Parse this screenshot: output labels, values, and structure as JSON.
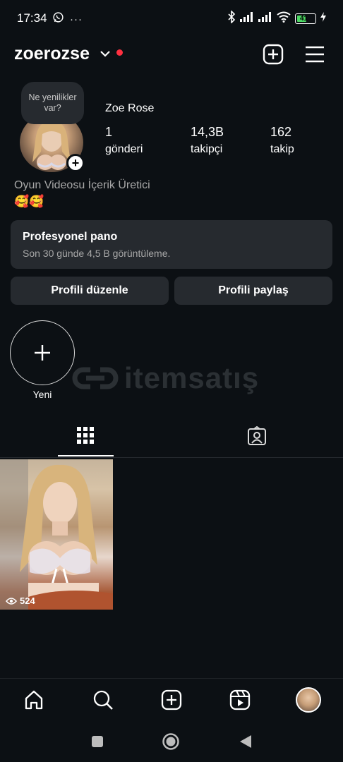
{
  "status_bar": {
    "time": "17:34",
    "more": "···",
    "battery": "41"
  },
  "header": {
    "username": "zoerozse"
  },
  "profile": {
    "note_bubble": "Ne yenilikler var?",
    "display_name": "Zoe Rose",
    "stats": [
      {
        "value": "1",
        "label": "gönderi"
      },
      {
        "value": "14,3B",
        "label": "takipçi"
      },
      {
        "value": "162",
        "label": "takip"
      }
    ],
    "bio": "Oyun Videosu İçerik Üretici",
    "bio_emoji": "🥰🥰"
  },
  "dashboard": {
    "title": "Profesyonel pano",
    "subtitle": "Son 30 günde 4,5 B görüntüleme."
  },
  "buttons": {
    "edit": "Profili düzenle",
    "share": "Profili paylaş"
  },
  "highlights": {
    "new_label": "Yeni"
  },
  "watermark": {
    "text": "itemsatış"
  },
  "posts": [
    {
      "views": "524"
    }
  ],
  "colors": {
    "background": "#0c1014",
    "card": "#262a2f",
    "red_dot": "#ff3040",
    "muted_text": "#a8a8a8"
  }
}
